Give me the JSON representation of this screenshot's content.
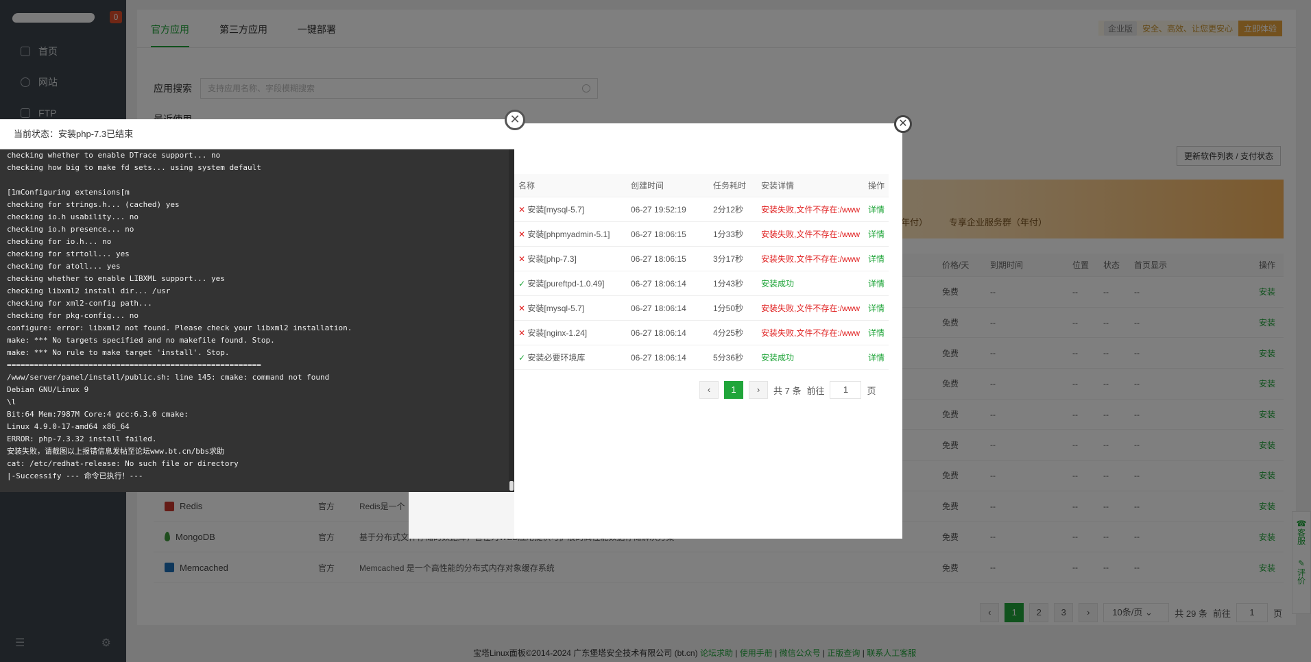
{
  "sidebar": {
    "badge": "0",
    "items": [
      {
        "label": "首页",
        "icon": "home-icon"
      },
      {
        "label": "网站",
        "icon": "globe-icon"
      },
      {
        "label": "FTP",
        "icon": "ftp-icon"
      }
    ]
  },
  "tabs": [
    "官方应用",
    "第三方应用",
    "一键部署"
  ],
  "promo": {
    "edition": "企业版",
    "slogan": "安全、高效、让您更安心",
    "button": "立即体验"
  },
  "search": {
    "label": "应用搜索",
    "placeholder": "支持应用名称、字段模糊搜索"
  },
  "recent_label": "最近使用",
  "update_button": "更新软件列表 / 支付状态",
  "banner": {
    "text1": "年付）",
    "text2": "专享企业服务群（年付）"
  },
  "softtable": {
    "headers": {
      "price": "价格/天",
      "expire": "到期时间",
      "position": "位置",
      "status": "状态",
      "home": "首页显示",
      "op": "操作"
    },
    "rows": [
      {
        "name": "",
        "developer": "",
        "desc": "",
        "price": "免费",
        "expire": "--",
        "pos": "--",
        "status": "--",
        "home": "--",
        "op": "安装"
      },
      {
        "name": "",
        "developer": "",
        "desc": "",
        "price": "免费",
        "expire": "--",
        "pos": "--",
        "status": "--",
        "home": "--",
        "op": "安装"
      },
      {
        "name": "",
        "developer": "",
        "desc": "",
        "price": "免费",
        "expire": "--",
        "pos": "--",
        "status": "--",
        "home": "--",
        "op": "安装"
      },
      {
        "name": "",
        "developer": "",
        "desc": "",
        "price": "免费",
        "expire": "--",
        "pos": "--",
        "status": "--",
        "home": "--",
        "op": "安装"
      },
      {
        "name": "",
        "developer": "",
        "desc": "",
        "price": "免费",
        "expire": "--",
        "pos": "--",
        "status": "--",
        "home": "--",
        "op": "安装"
      },
      {
        "name": "",
        "developer": "",
        "desc": "",
        "price": "免费",
        "expire": "--",
        "pos": "--",
        "status": "--",
        "home": "--",
        "op": "安装"
      },
      {
        "name": "",
        "developer": "",
        "desc": "",
        "price": "免费",
        "expire": "--",
        "pos": "--",
        "status": "--",
        "home": "--",
        "op": "安装"
      },
      {
        "name": "Redis",
        "developer": "官方",
        "desc": "Redis是一个",
        "price": "免费",
        "expire": "--",
        "pos": "--",
        "status": "--",
        "home": "--",
        "op": "安装"
      },
      {
        "name": "MongoDB",
        "developer": "官方",
        "desc": "基于分布式文件存储的数据库，旨在为WEB应用提供可扩展的高性能数据存储解决方案",
        "price": "免费",
        "expire": "--",
        "pos": "--",
        "status": "--",
        "home": "--",
        "op": "安装"
      },
      {
        "name": "Memcached",
        "developer": "官方",
        "desc": "Memcached 是一个高性能的分布式内存对象缓存系统",
        "price": "免费",
        "expire": "--",
        "pos": "--",
        "status": "--",
        "home": "--",
        "op": "安装"
      }
    ]
  },
  "pager": {
    "pages": [
      "1",
      "2",
      "3"
    ],
    "per_page": "10条/页",
    "total": "共 29 条",
    "goto": "前往",
    "page_value": "1",
    "unit": "页"
  },
  "footer": {
    "copyright": "宝塔Linux面板©2014-2024 广东堡塔安全技术有限公司 (bt.cn)",
    "links": [
      "论坛求助",
      "使用手册",
      "微信公众号",
      "正版查询",
      "联系人工客服"
    ]
  },
  "sidetools": {
    "service": "客服",
    "review": "评价"
  },
  "taskdialog": {
    "headers": {
      "name": "名称",
      "time": "创建时间",
      "cost": "任务耗时",
      "detail": "安装详情",
      "op": "操作"
    },
    "rows": [
      {
        "name": "安装[mysql-5.7]",
        "time": "06-27 19:52:19",
        "cost": "2分12秒",
        "detail": "安装失败,文件不存在:/www",
        "op": "详情",
        "ok": false
      },
      {
        "name": "安装[phpmyadmin-5.1]",
        "time": "06-27 18:06:15",
        "cost": "1分33秒",
        "detail": "安装失败,文件不存在:/www",
        "op": "详情",
        "ok": false
      },
      {
        "name": "安装[php-7.3]",
        "time": "06-27 18:06:15",
        "cost": "3分17秒",
        "detail": "安装失败,文件不存在:/www",
        "op": "详情",
        "ok": false
      },
      {
        "name": "安装[pureftpd-1.0.49]",
        "time": "06-27 18:06:14",
        "cost": "1分43秒",
        "detail": "安装成功",
        "op": "详情",
        "ok": true
      },
      {
        "name": "安装[mysql-5.7]",
        "time": "06-27 18:06:14",
        "cost": "1分50秒",
        "detail": "安装失败,文件不存在:/www",
        "op": "详情",
        "ok": false
      },
      {
        "name": "安装[nginx-1.24]",
        "time": "06-27 18:06:14",
        "cost": "4分25秒",
        "detail": "安装失败,文件不存在:/www",
        "op": "详情",
        "ok": false
      },
      {
        "name": "安装必要环境库",
        "time": "06-27 18:06:14",
        "cost": "5分36秒",
        "detail": "安装成功",
        "op": "详情",
        "ok": true
      }
    ],
    "pager": {
      "page": "1",
      "total": "共 7 条",
      "goto": "前往",
      "page_value": "1",
      "unit": "页"
    }
  },
  "logdialog": {
    "title": "当前状态：安装php-7.3已结束",
    "lines": [
      "checking whether to enable DTrace support... no",
      "checking how big to make fd sets... using system default",
      "",
      "\u001b[1mConfiguring extensions\u001b[m",
      "checking for strings.h... (cached) yes",
      "checking io.h usability... no",
      "checking io.h presence... no",
      "checking for io.h... no",
      "checking for strtoll... yes",
      "checking for atoll... yes",
      "checking whether to enable LIBXML support... yes",
      "checking libxml2 install dir... /usr",
      "checking for xml2-config path...",
      "checking for pkg-config... no",
      "configure: error: libxml2 not found. Please check your libxml2 installation.",
      "make: *** No targets specified and no makefile found. Stop.",
      "make: *** No rule to make target 'install'. Stop.",
      "========================================================",
      "/www/server/panel/install/public.sh: line 145: cmake: command not found",
      "Debian GNU/Linux 9",
      "\\l",
      "Bit:64 Mem:7987M Core:4 gcc:6.3.0 cmake:",
      "Linux 4.9.0-17-amd64 x86_64",
      "ERROR: php-7.3.32 install failed.",
      "安装失败，请截图以上报错信息发帖至论坛www.bt.cn/bbs求助",
      "cat: /etc/redhat-release: No such file or directory",
      "|-Successify --- 命令已执行！---"
    ]
  }
}
